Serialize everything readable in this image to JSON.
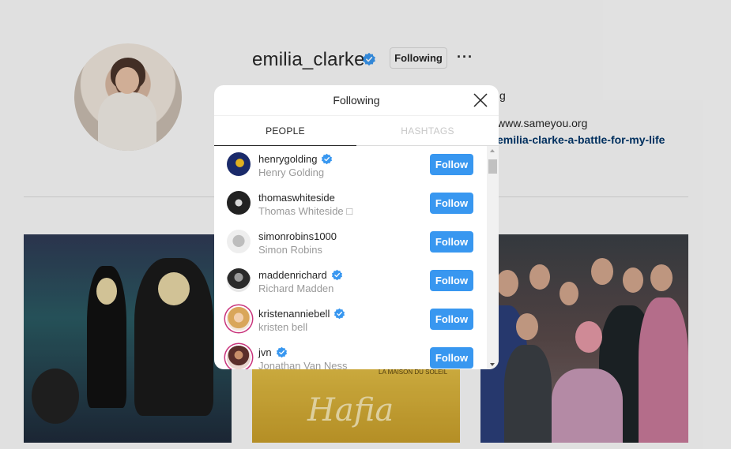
{
  "profile": {
    "username": "emilia_clarke",
    "following_label": "Following",
    "more_label": "···",
    "bio_partial": "g",
    "website_partial": "www.sameyou.org",
    "link_partial": "emilia-clarke-a-battle-for-my-life"
  },
  "posts": {
    "caption_fragment": "Hafia",
    "small_text": "LA MAISON DU SOLEIL"
  },
  "modal": {
    "title": "Following",
    "tabs": [
      "PEOPLE",
      "HASHTAGS"
    ],
    "follow_label": "Follow",
    "people": [
      {
        "username": "henrygolding",
        "full_name": "Henry Golding",
        "verified": true
      },
      {
        "username": "thomaswhiteside",
        "full_name": "Thomas Whiteside □",
        "verified": false
      },
      {
        "username": "simonrobins1000",
        "full_name": "Simon Robins",
        "verified": false
      },
      {
        "username": "maddenrichard",
        "full_name": "Richard Madden",
        "verified": true
      },
      {
        "username": "kristenanniebell",
        "full_name": "kristen bell",
        "verified": true
      },
      {
        "username": "jvn",
        "full_name": "Jonathan Van Ness",
        "verified": true
      }
    ]
  },
  "colors": {
    "follow_blue": "#3897f0",
    "verified_blue": "#3897f0",
    "link_blue": "#003569"
  }
}
